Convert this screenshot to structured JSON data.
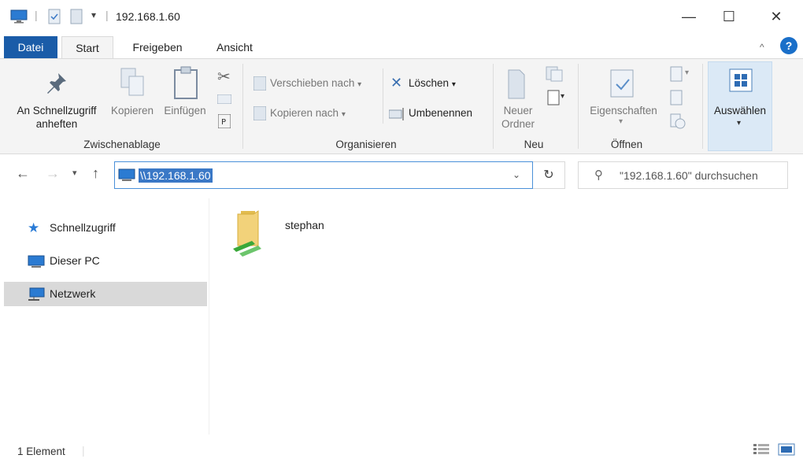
{
  "window": {
    "title": "192.168.1.60",
    "minimize": "—",
    "maximize": "☐",
    "close": "✕"
  },
  "tabs": {
    "file": "Datei",
    "start": "Start",
    "share": "Freigeben",
    "view": "Ansicht",
    "help": "?"
  },
  "ribbon": {
    "clipboard": {
      "pin_label": "An Schnellzugriff anheften",
      "copy_label": "Kopieren",
      "paste_label": "Einfügen",
      "group_label": "Zwischenablage"
    },
    "organize": {
      "move_label": "Verschieben nach",
      "copy_to_label": "Kopieren nach",
      "delete_label": "Löschen",
      "rename_label": "Umbenennen",
      "group_label": "Organisieren"
    },
    "new": {
      "new_folder_label": "Neuer Ordner",
      "group_label": "Neu"
    },
    "open": {
      "properties_label": "Eigenschaften",
      "group_label": "Öffnen"
    },
    "select": {
      "select_label": "Auswählen"
    }
  },
  "address": {
    "path": "\\\\192.168.1.60",
    "search_placeholder": "\"192.168.1.60\" durchsuchen"
  },
  "sidebar": {
    "items": [
      {
        "label": "Schnellzugriff"
      },
      {
        "label": "Dieser PC"
      },
      {
        "label": "Netzwerk"
      }
    ]
  },
  "content": {
    "items": [
      {
        "label": "stephan"
      }
    ]
  },
  "status": {
    "count": "1 Element"
  },
  "colors": {
    "accent": "#1a5ca8",
    "selection": "#3a78c6",
    "ribbon_bg": "#f4f4f4"
  }
}
